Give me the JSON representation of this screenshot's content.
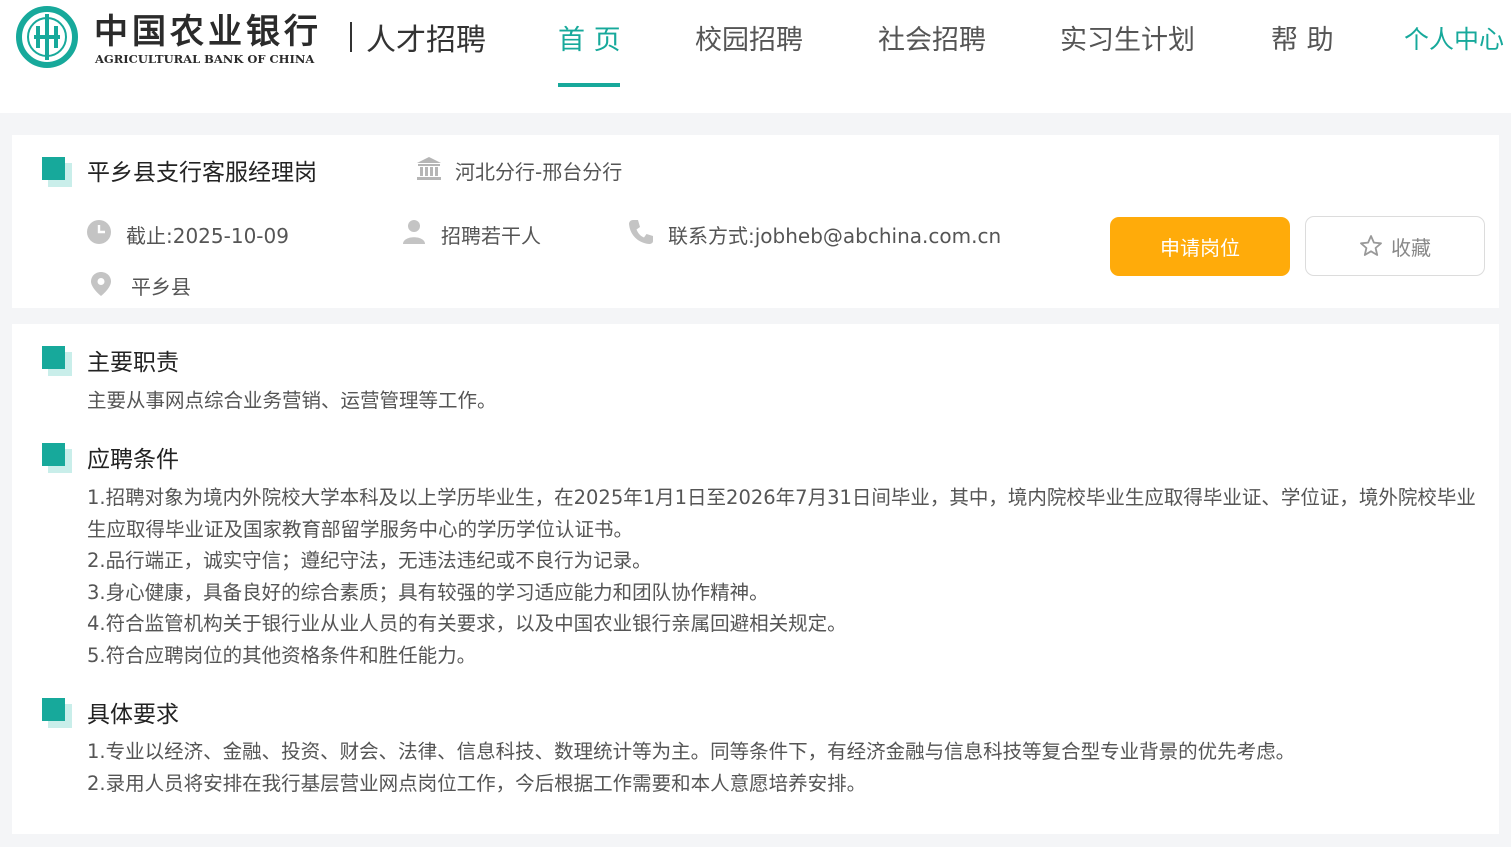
{
  "brand": {
    "name_cn": "中国农业银行",
    "name_en": "AGRICULTURAL BANK OF CHINA",
    "subtitle": "人才招聘",
    "logo_icon": "abc-bank-logo-icon",
    "color": "#17a99b"
  },
  "nav": {
    "items": [
      {
        "label": "首 页",
        "active": true
      },
      {
        "label": "校园招聘"
      },
      {
        "label": "社会招聘"
      },
      {
        "label": "实习生计划"
      },
      {
        "label": "帮 助"
      }
    ],
    "personal": "个人中心"
  },
  "job": {
    "title": "平乡县支行客服经理岗",
    "branch_icon": "bank-building-icon",
    "branch": "河北分行-邢台分行",
    "deadline_icon": "clock-icon",
    "deadline": "截止:2025-10-09",
    "headcount_icon": "person-icon",
    "headcount": "招聘若干人",
    "contact_icon": "phone-icon",
    "contact": "联系方式:jobheb@abchina.com.cn",
    "location_icon": "location-pin-icon",
    "location": "平乡县",
    "apply_label": "申请岗位",
    "apply_color": "#ffab0a",
    "favorite_icon": "star-icon",
    "favorite_label": "收藏"
  },
  "sections": {
    "duties": {
      "title": "主要职责",
      "lines": [
        "主要从事网点综合业务营销、运营管理等工作。"
      ]
    },
    "conditions": {
      "title": "应聘条件",
      "lines": [
        "1.招聘对象为境内外院校大学本科及以上学历毕业生，在2025年1月1日至2026年7月31日间毕业，其中，境内院校毕业生应取得毕业证、学位证，境外院校毕业生应取得毕业证及国家教育部留学服务中心的学历学位认证书。",
        "2.品行端正，诚实守信；遵纪守法，无违法违纪或不良行为记录。",
        "3.身心健康，具备良好的综合素质；具有较强的学习适应能力和团队协作精神。",
        "4.符合监管机构关于银行业从业人员的有关要求，以及中国农业银行亲属回避相关规定。",
        "5.符合应聘岗位的其他资格条件和胜任能力。"
      ]
    },
    "requirements": {
      "title": "具体要求",
      "lines": [
        "1.专业以经济、金融、投资、财会、法律、信息科技、数理统计等为主。同等条件下，有经济金融与信息科技等复合型专业背景的优先考虑。",
        "2.录用人员将安排在我行基层营业网点岗位工作，今后根据工作需要和本人意愿培养安排。"
      ]
    }
  }
}
